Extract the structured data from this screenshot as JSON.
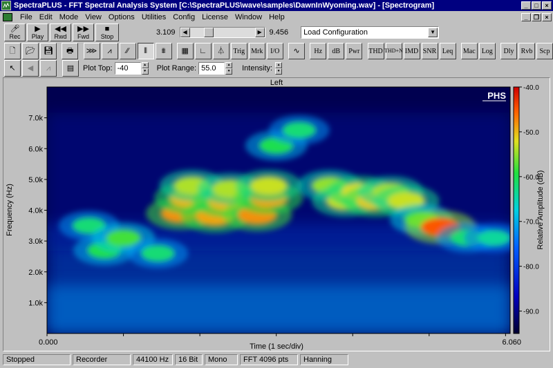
{
  "window": {
    "title": "SpectraPLUS - FFT Spectral Analysis System [C:\\SpectraPLUS\\wave\\samples\\DawnInWyoming.wav] - [Spectrogram]"
  },
  "menu": {
    "items": [
      "File",
      "Edit",
      "Mode",
      "View",
      "Options",
      "Utilities",
      "Config",
      "License",
      "Window",
      "Help"
    ]
  },
  "transport": {
    "rec": "Rec",
    "play": "Play",
    "rwd": "Rwd",
    "fwd": "Fwd",
    "stop": "Stop"
  },
  "position": {
    "start": "3.109",
    "end": "9.456",
    "slider_fraction": 0.25
  },
  "config_combo": {
    "value": "Load Configuration"
  },
  "toolbar2": {
    "text_buttons": [
      "Trig",
      "Mrk",
      "I/O",
      "Hz",
      "dB",
      "Pwr",
      "THD",
      "THD+N",
      "IMD",
      "SNR",
      "Leq",
      "Mac",
      "Log",
      "Dly",
      "Rvb",
      "Scp"
    ]
  },
  "plot_controls": {
    "plot_top_label": "Plot Top:",
    "plot_top_value": "-40",
    "plot_range_label": "Plot Range:",
    "plot_range_value": "55.0",
    "intensity_label": "Intensity:"
  },
  "chart_data": {
    "type": "heatmap",
    "title": "Left",
    "xlabel": "Time (1 sec/div)",
    "ylabel": "Frequency (Hz)",
    "xlim": [
      0.0,
      6.06
    ],
    "x_tick_labels": [
      "0.000",
      "6.060"
    ],
    "ylim": [
      0,
      8000
    ],
    "y_ticks": [
      1000,
      2000,
      3000,
      4000,
      5000,
      6000,
      7000
    ],
    "y_tick_labels": [
      "1.0k",
      "2.0k",
      "3.0k",
      "4.0k",
      "5.0k",
      "6.0k",
      "7.0k"
    ],
    "colorbar": {
      "label": "Relative Amplitude (dB)",
      "range": [
        -95,
        -40
      ],
      "ticks": [
        -40,
        -50,
        -60,
        -70,
        -80,
        -90
      ],
      "tick_labels": [
        "-40.0",
        "-50.0",
        "-60.0",
        "-70.0",
        "-80.0",
        "-90.0"
      ]
    },
    "watermark": "PHS",
    "blobs": [
      {
        "t": 0.55,
        "f": 3500,
        "amp": -62
      },
      {
        "t": 0.75,
        "f": 2700,
        "amp": -60
      },
      {
        "t": 1.0,
        "f": 3100,
        "amp": -58
      },
      {
        "t": 1.45,
        "f": 2600,
        "amp": -62
      },
      {
        "t": 1.75,
        "f": 3900,
        "amp": -48
      },
      {
        "t": 1.85,
        "f": 4400,
        "amp": -50
      },
      {
        "t": 1.9,
        "f": 4800,
        "amp": -54
      },
      {
        "t": 2.2,
        "f": 3800,
        "amp": -49
      },
      {
        "t": 2.35,
        "f": 4300,
        "amp": -50
      },
      {
        "t": 2.4,
        "f": 4700,
        "amp": -54
      },
      {
        "t": 2.75,
        "f": 3850,
        "amp": -48
      },
      {
        "t": 2.9,
        "f": 4400,
        "amp": -49
      },
      {
        "t": 2.9,
        "f": 4800,
        "amp": -53
      },
      {
        "t": 3.0,
        "f": 6100,
        "amp": -60
      },
      {
        "t": 3.3,
        "f": 6600,
        "amp": -62
      },
      {
        "t": 3.7,
        "f": 4800,
        "amp": -55
      },
      {
        "t": 3.9,
        "f": 4300,
        "amp": -53
      },
      {
        "t": 4.1,
        "f": 4600,
        "amp": -52
      },
      {
        "t": 4.3,
        "f": 4300,
        "amp": -51
      },
      {
        "t": 4.5,
        "f": 4600,
        "amp": -54
      },
      {
        "t": 4.7,
        "f": 4300,
        "amp": -53
      },
      {
        "t": 4.9,
        "f": 3700,
        "amp": -58
      },
      {
        "t": 5.15,
        "f": 3450,
        "amp": -45
      },
      {
        "t": 5.5,
        "f": 3100,
        "amp": -62
      },
      {
        "t": 5.85,
        "f": 3100,
        "amp": -64
      }
    ]
  },
  "status": {
    "cells": [
      "Stopped",
      "Recorder",
      "44100 Hz",
      "16 Bit",
      "Mono",
      "FFT 4096 pts",
      "Hanning"
    ]
  }
}
